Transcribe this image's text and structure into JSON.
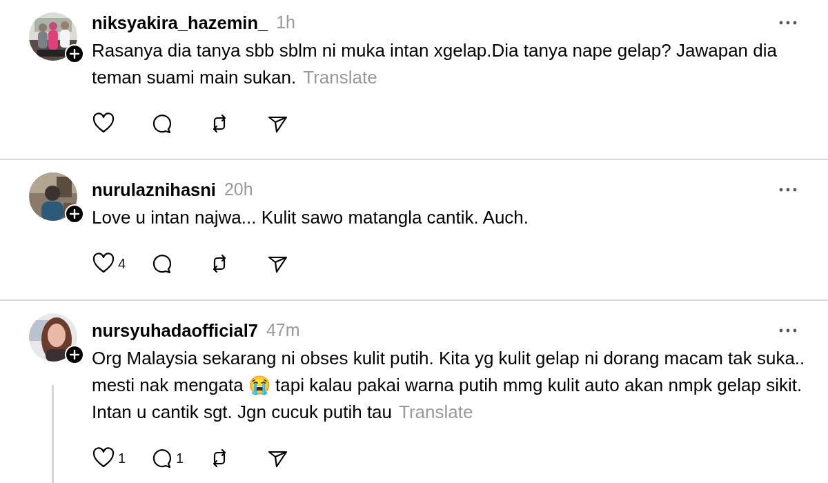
{
  "posts": [
    {
      "username": "niksyakira_hazemin_",
      "time": "1h",
      "text": "Rasanya dia tanya sbb sblm ni muka intan xgelap.Dia tanya nape gelap? Jawapan dia teman suami main sukan.",
      "translate": "Translate",
      "thread_line": false
    },
    {
      "username": "nurulaznihasni",
      "time": "20h",
      "text": "Love u intan najwa... Kulit sawo matangla cantik. Auch.",
      "likes": "4",
      "thread_line": false
    },
    {
      "username": "nursyuhadaofficial7",
      "time": "47m",
      "text": "Org Malaysia sekarang ni obses kulit putih. Kita yg kulit gelap ni dorang macam tak suka.. mesti nak mengata 😭  tapi kalau pakai warna putih mmg kulit auto akan nmpk gelap sikit. Intan u cantik sgt. Jgn cucuk putih tau",
      "translate": "Translate",
      "likes": "1",
      "replies": "1",
      "thread_line": true
    }
  ]
}
